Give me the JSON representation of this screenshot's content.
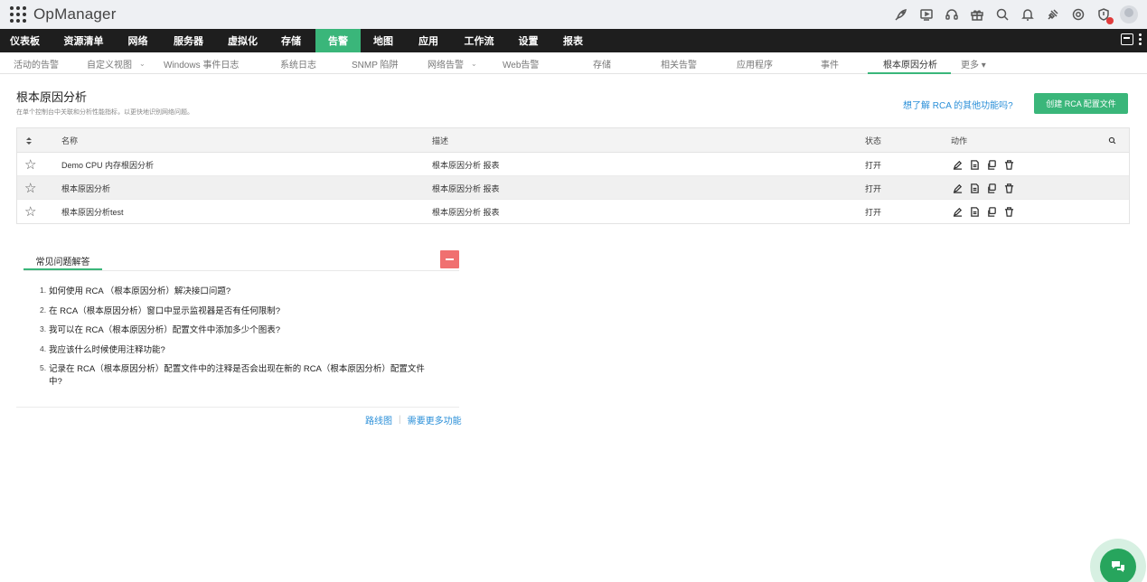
{
  "app": {
    "title": "OpManager"
  },
  "main_nav": {
    "items": [
      {
        "label": "仪表板",
        "active": false
      },
      {
        "label": "资源清单",
        "active": false
      },
      {
        "label": "网络",
        "active": false
      },
      {
        "label": "服务器",
        "active": false
      },
      {
        "label": "虚拟化",
        "active": false
      },
      {
        "label": "存储",
        "active": false
      },
      {
        "label": "告警",
        "active": true
      },
      {
        "label": "地图",
        "active": false
      },
      {
        "label": "应用",
        "active": false
      },
      {
        "label": "工作流",
        "active": false
      },
      {
        "label": "设置",
        "active": false
      },
      {
        "label": "报表",
        "active": false
      }
    ],
    "active_color": "#3ab67a"
  },
  "sub_nav": {
    "items": [
      {
        "label": "活动的告警"
      },
      {
        "label": "自定义视图",
        "dropdown": true
      },
      {
        "label": "Windows 事件日志"
      },
      {
        "label": "系统日志"
      },
      {
        "label": "SNMP 陷阱"
      },
      {
        "label": "网络告警",
        "dropdown": true
      },
      {
        "label": "Web告警"
      },
      {
        "label": "存储"
      },
      {
        "label": "相关告警"
      },
      {
        "label": "应用程序"
      },
      {
        "label": "事件"
      },
      {
        "label": "根本原因分析",
        "active": true
      },
      {
        "label": "更多 ▾"
      }
    ]
  },
  "page": {
    "title": "根本原因分析",
    "subtitle": "在单个控制台中关联和分析性能指标，以更快地识别网络问题。",
    "learn_more": "想了解 RCA 的其他功能吗?",
    "create_button": "创建 RCA 配置文件"
  },
  "table": {
    "headers": {
      "name": "名称",
      "description": "描述",
      "status": "状态",
      "actions": "动作"
    },
    "rows": [
      {
        "name": "Demo CPU 内存根因分析",
        "description": "根本原因分析 报表",
        "status": "打开"
      },
      {
        "name": "根本原因分析",
        "description": "根本原因分析 报表",
        "status": "打开"
      },
      {
        "name": "根本原因分析test",
        "description": "根本原因分析 报表",
        "status": "打开"
      }
    ]
  },
  "faq": {
    "tab_label": "常见问题解答",
    "items": [
      {
        "num": "1.",
        "text": "如何使用 RCA （根本原因分析）解决接口问题?"
      },
      {
        "num": "2.",
        "text": "在 RCA（根本原因分析）窗口中显示监视器是否有任何限制?"
      },
      {
        "num": "3.",
        "text": "我可以在 RCA（根本原因分析）配置文件中添加多少个图表?"
      },
      {
        "num": "4.",
        "text": "我应该什么时候使用注释功能?"
      },
      {
        "num": "5.",
        "text": "记录在 RCA（根本原因分析）配置文件中的注释是否会出现在新的 RCA（根本原因分析）配置文件中?"
      }
    ]
  },
  "footer": {
    "roadmap": "路线图",
    "separator": "|",
    "more_features": "需要更多功能"
  },
  "colors": {
    "accent": "#3ab67a",
    "link": "#2a8fd8",
    "collapse": "#f07070",
    "nav_bg": "#1e1e1e"
  }
}
